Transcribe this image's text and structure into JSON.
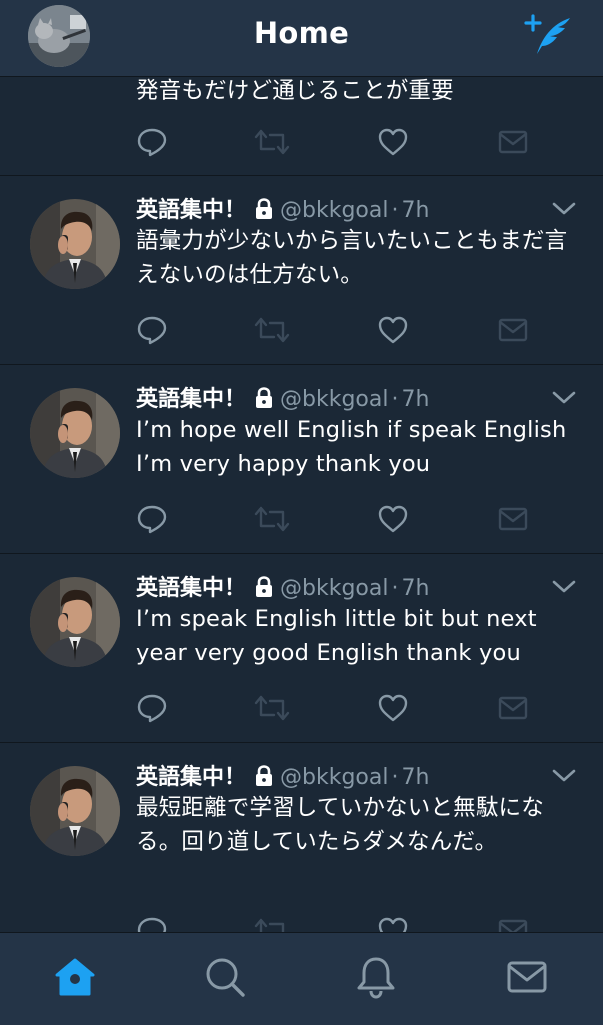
{
  "header": {
    "title": "Home",
    "profile_icon": "profile-avatar",
    "compose_icon": "compose-tweet-icon",
    "accent": "#1da1f2"
  },
  "top_partial_tweet": {
    "text": "発音もだけど通じることが重要"
  },
  "tweets": [
    {
      "name": "英語集中！",
      "handle": "@bkkgoal",
      "sep": "·",
      "time": "7h",
      "text": "語彙力が少ないから言いたいこともまだ言えないのは仕方ない。"
    },
    {
      "name": "英語集中！",
      "handle": "@bkkgoal",
      "sep": "·",
      "time": "7h",
      "text": "I’m hope well English if speak English I’m very happy thank you"
    },
    {
      "name": "英語集中！",
      "handle": "@bkkgoal",
      "sep": "·",
      "time": "7h",
      "text": "I’m speak English little bit but next year very good English thank you"
    },
    {
      "name": "英語集中！",
      "handle": "@bkkgoal",
      "sep": "·",
      "time": "7h",
      "text": "最短距離で学習していかないと無駄になる。回り道していたらダメなんだ。"
    }
  ],
  "tabbar": {
    "items": [
      "home-icon",
      "search-icon",
      "notifications-icon",
      "messages-icon"
    ],
    "active": "home-icon"
  },
  "colors": {
    "background": "#1b2836",
    "bar": "#243447",
    "muted": "#8899a6",
    "accent": "#1da1f2"
  }
}
